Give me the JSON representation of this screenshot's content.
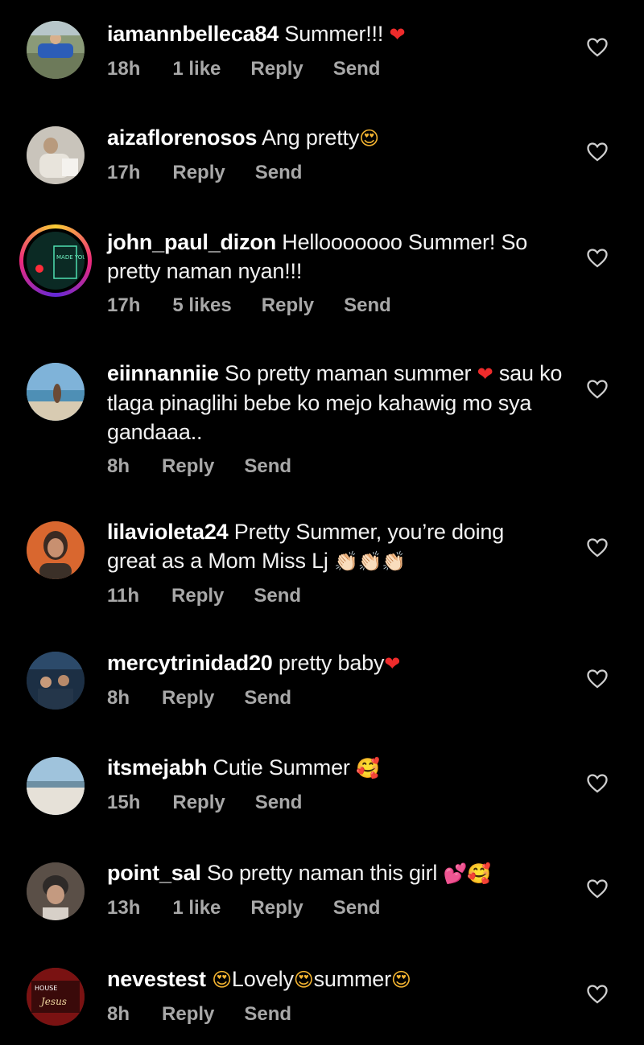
{
  "colors": {
    "background": "#000000",
    "text": "#f2f2f2",
    "meta": "#a8a8a8",
    "heart_emoji": "#ee2b2b"
  },
  "comments": [
    {
      "username": "iamannbelleca84",
      "text": " Summer!!! ",
      "emoji": "❤",
      "time": "18h",
      "likes": "1 like",
      "reply": "Reply",
      "send": "Send"
    },
    {
      "username": "aizaflorenosos",
      "text": " Ang pretty",
      "emoji": "😍",
      "time": "17h",
      "reply": "Reply",
      "send": "Send"
    },
    {
      "username": "john_paul_dizon",
      "text": " Hellooooooo Summer! So pretty naman nyan!!!",
      "time": "17h",
      "likes": "5 likes",
      "reply": "Reply",
      "send": "Send"
    },
    {
      "username": "eiinnanniie",
      "text": " So pretty maman summer ",
      "emoji": "❤",
      "text2": " sau ko tlaga pinaglihi bebe ko mejo kahawig mo sya gandaaa..",
      "time": "8h",
      "reply": "Reply",
      "send": "Send"
    },
    {
      "username": "lilavioleta24",
      "text": " Pretty Summer, you’re doing great as a Mom Miss Lj ",
      "emoji": "👏🏻👏🏻👏🏻",
      "time": "11h",
      "reply": "Reply",
      "send": "Send"
    },
    {
      "username": "mercytrinidad20",
      "text": " pretty baby",
      "emoji": "❤",
      "time": "8h",
      "reply": "Reply",
      "send": "Send"
    },
    {
      "username": "itsmejabh",
      "text": " Cutie Summer ",
      "emoji": "🥰",
      "time": "15h",
      "reply": "Reply",
      "send": "Send"
    },
    {
      "username": "point_sal",
      "text": " So pretty naman this girl ",
      "emoji": "💕🥰",
      "time": "13h",
      "likes": "1 like",
      "reply": "Reply",
      "send": "Send"
    },
    {
      "username": "nevestest",
      "emoji_a": "😍",
      "text": "Lovely",
      "emoji_b": "😍",
      "text2": "summer",
      "emoji_c": "😍",
      "time": "8h",
      "reply": "Reply",
      "send": "Send"
    }
  ],
  "avatars": {
    "comment_3_text": "MADE YOU LOOK",
    "comment_10_text_1": "HOUSE",
    "comment_10_text_2": "Jesus"
  },
  "icons": {
    "like": "heart-outline-icon"
  }
}
